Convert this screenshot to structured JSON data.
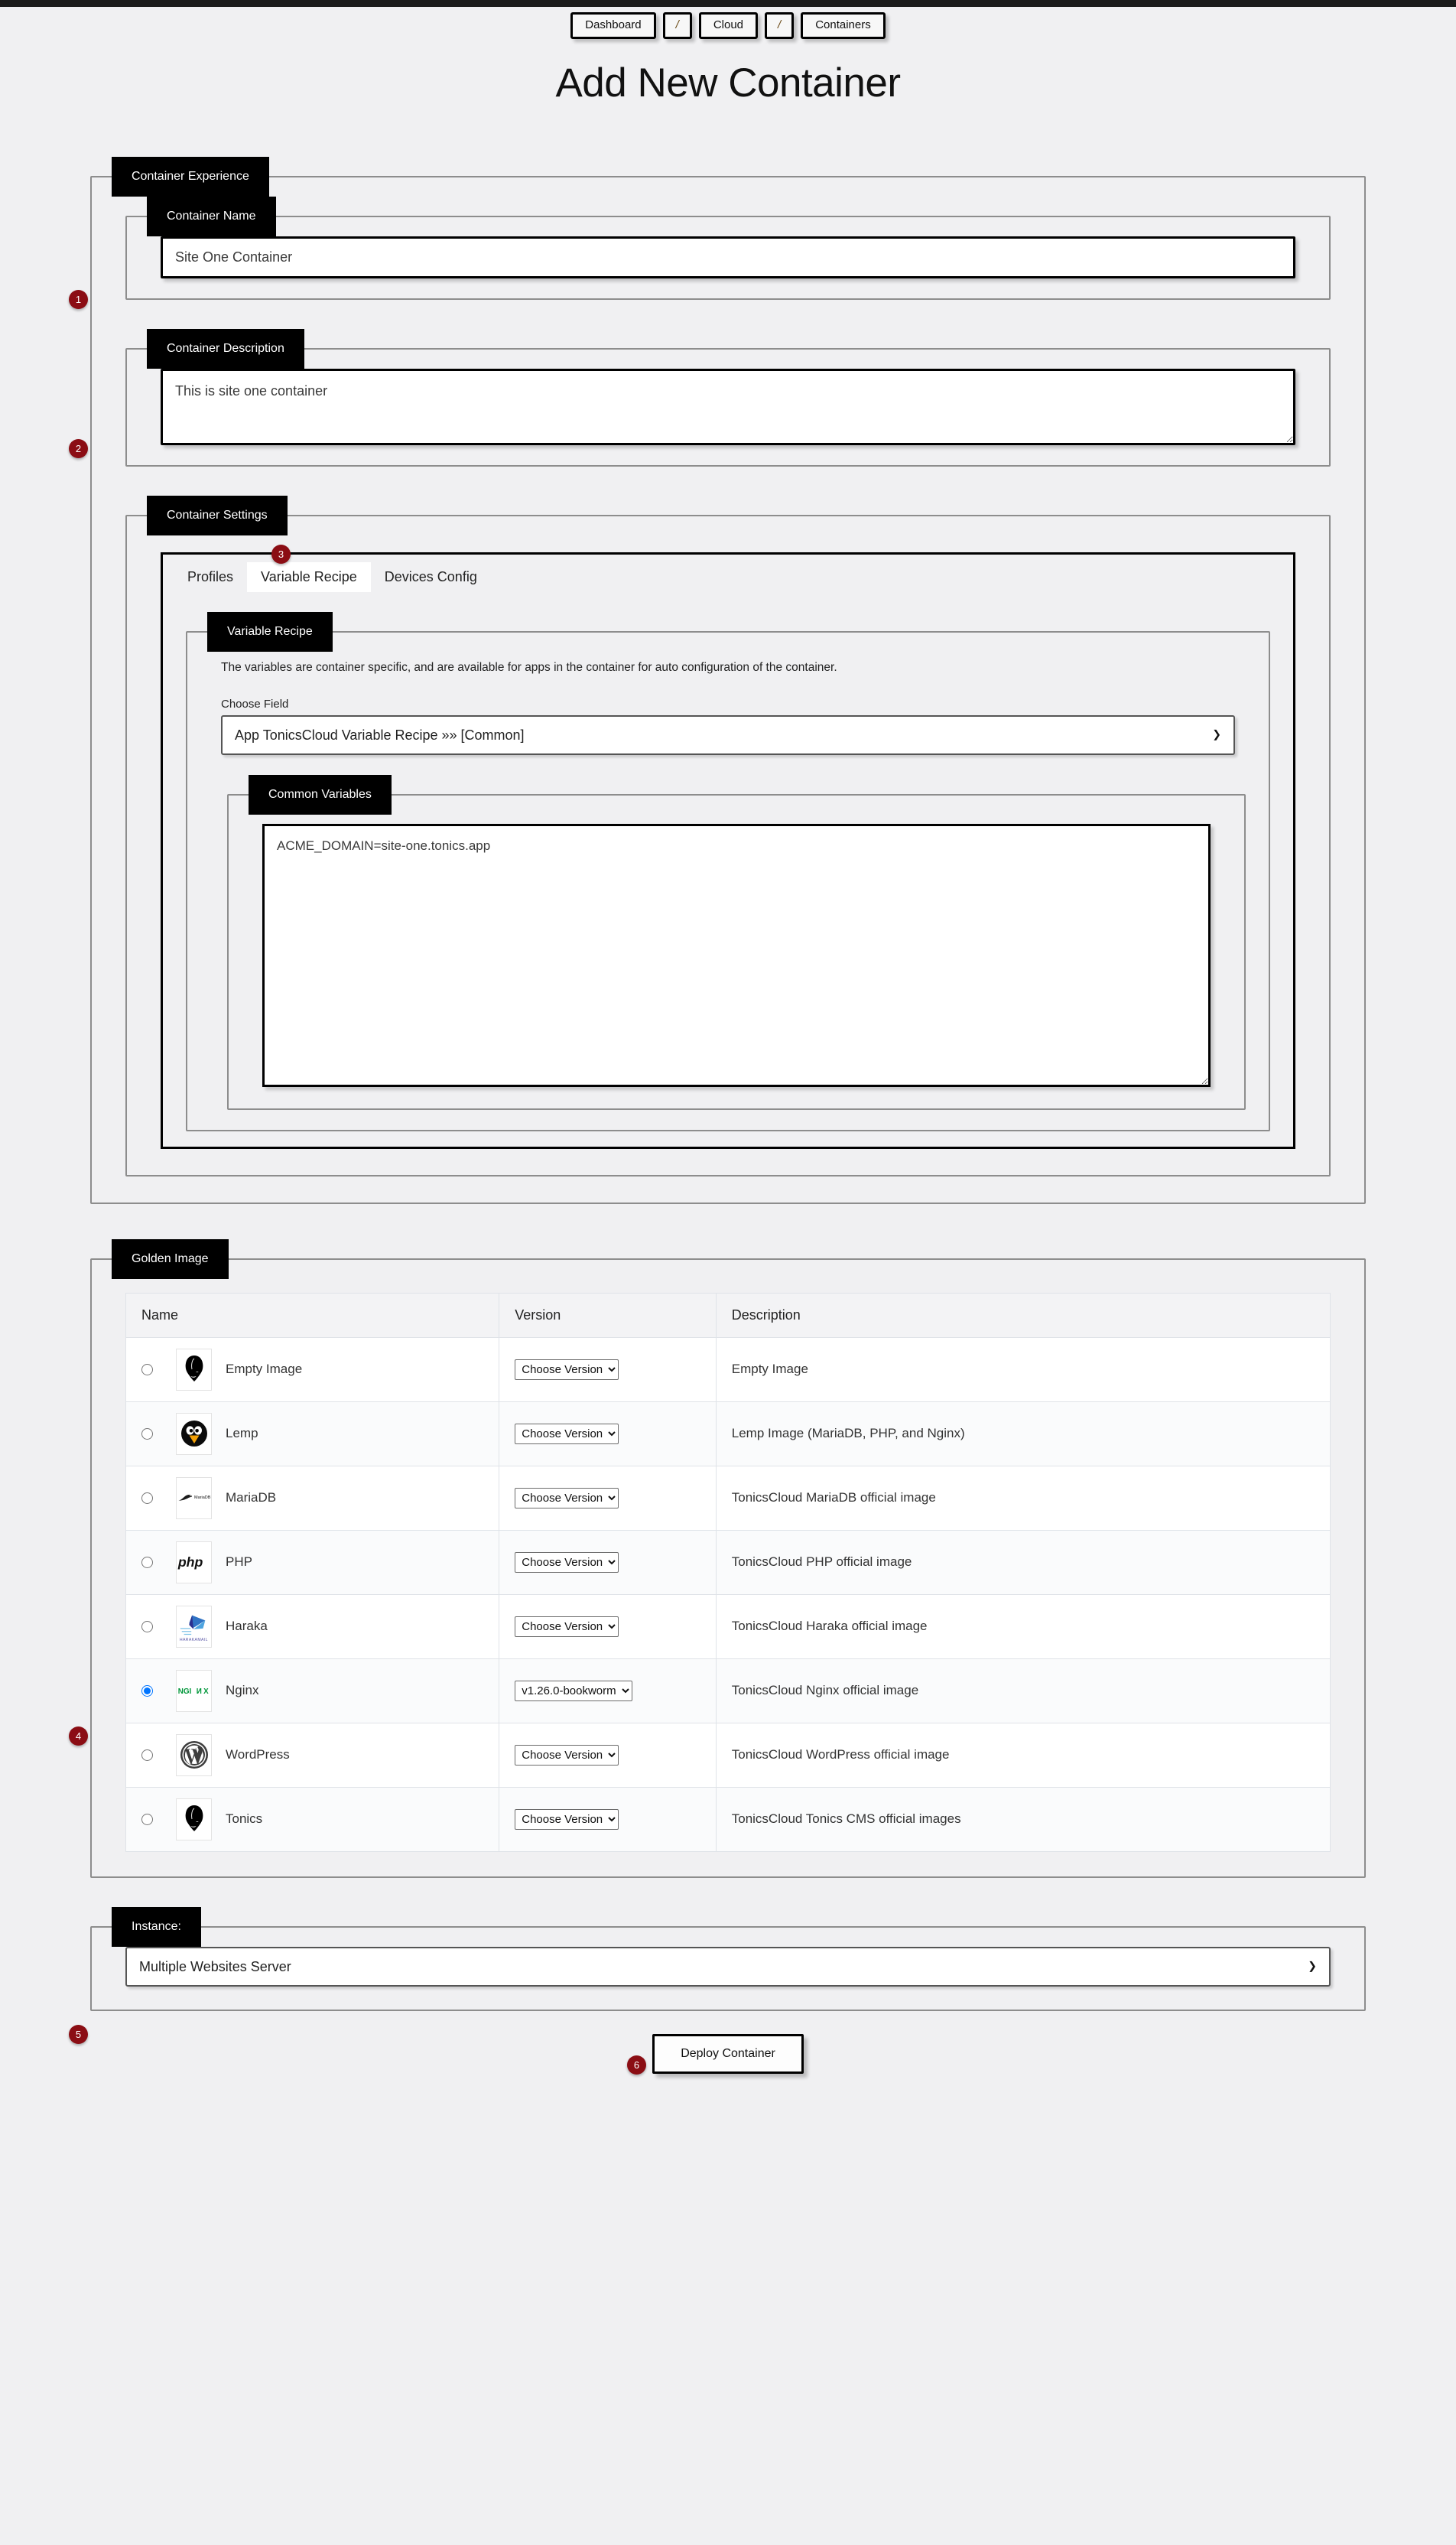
{
  "breadcrumb": [
    {
      "label": "Dashboard",
      "type": "link"
    },
    {
      "label": "/",
      "type": "separator"
    },
    {
      "label": "Cloud",
      "type": "link"
    },
    {
      "label": "/",
      "type": "separator"
    },
    {
      "label": "Containers",
      "type": "link"
    }
  ],
  "page_title": "Add New Container",
  "container_experience": {
    "legend": "Container Experience",
    "container_name": {
      "legend": "Container Name",
      "value": "Site One Container"
    },
    "container_description": {
      "legend": "Container Description",
      "value": "This is site one container"
    },
    "container_settings": {
      "legend": "Container Settings",
      "tabs": [
        {
          "label": "Profiles",
          "active": false
        },
        {
          "label": "Variable Recipe",
          "active": true
        },
        {
          "label": "Devices Config",
          "active": false
        }
      ],
      "variable_recipe": {
        "legend": "Variable Recipe",
        "description": "The variables are container specific, and are available for apps in the container for auto configuration of the container.",
        "choose_field_label": "Choose Field",
        "choose_field_value": "App TonicsCloud Variable Recipe »» [Common]",
        "common_variables": {
          "legend": "Common Variables",
          "value": "ACME_DOMAIN=site-one.tonics.app"
        }
      }
    }
  },
  "golden_image": {
    "legend": "Golden Image",
    "columns": [
      "Name",
      "Version",
      "Description"
    ],
    "rows": [
      {
        "name": "Empty Image",
        "logo": "tonics-mask-icon",
        "version": "Choose Version",
        "description": "Empty Image",
        "selected": false
      },
      {
        "name": "Lemp",
        "logo": "penguin-icon",
        "version": "Choose Version",
        "description": "Lemp Image (MariaDB, PHP, and Nginx)",
        "selected": false
      },
      {
        "name": "MariaDB",
        "logo": "mariadb-icon",
        "version": "Choose Version",
        "description": "TonicsCloud MariaDB official image",
        "selected": false
      },
      {
        "name": "PHP",
        "logo": "php-icon",
        "version": "Choose Version",
        "description": "TonicsCloud PHP official image",
        "selected": false
      },
      {
        "name": "Haraka",
        "logo": "harakamail-icon",
        "version": "Choose Version",
        "description": "TonicsCloud Haraka official image",
        "selected": false
      },
      {
        "name": "Nginx",
        "logo": "nginx-icon",
        "version": "v1.26.0-bookworm",
        "description": "TonicsCloud Nginx official image",
        "selected": true
      },
      {
        "name": "WordPress",
        "logo": "wordpress-icon",
        "version": "Choose Version",
        "description": "TonicsCloud WordPress official image",
        "selected": false
      },
      {
        "name": "Tonics",
        "logo": "tonics-mask-icon",
        "version": "Choose Version",
        "description": "TonicsCloud Tonics CMS official images",
        "selected": false
      }
    ]
  },
  "instance": {
    "legend": "Instance:",
    "value": "Multiple Websites Server"
  },
  "deploy_button": "Deploy Container",
  "markers": [
    "1",
    "2",
    "3",
    "4",
    "5",
    "6"
  ],
  "colors": {
    "marker": "#8b0d14",
    "legend_bg": "#000000",
    "page_bg": "#f0f0f2",
    "nginx_green": "#009639"
  }
}
